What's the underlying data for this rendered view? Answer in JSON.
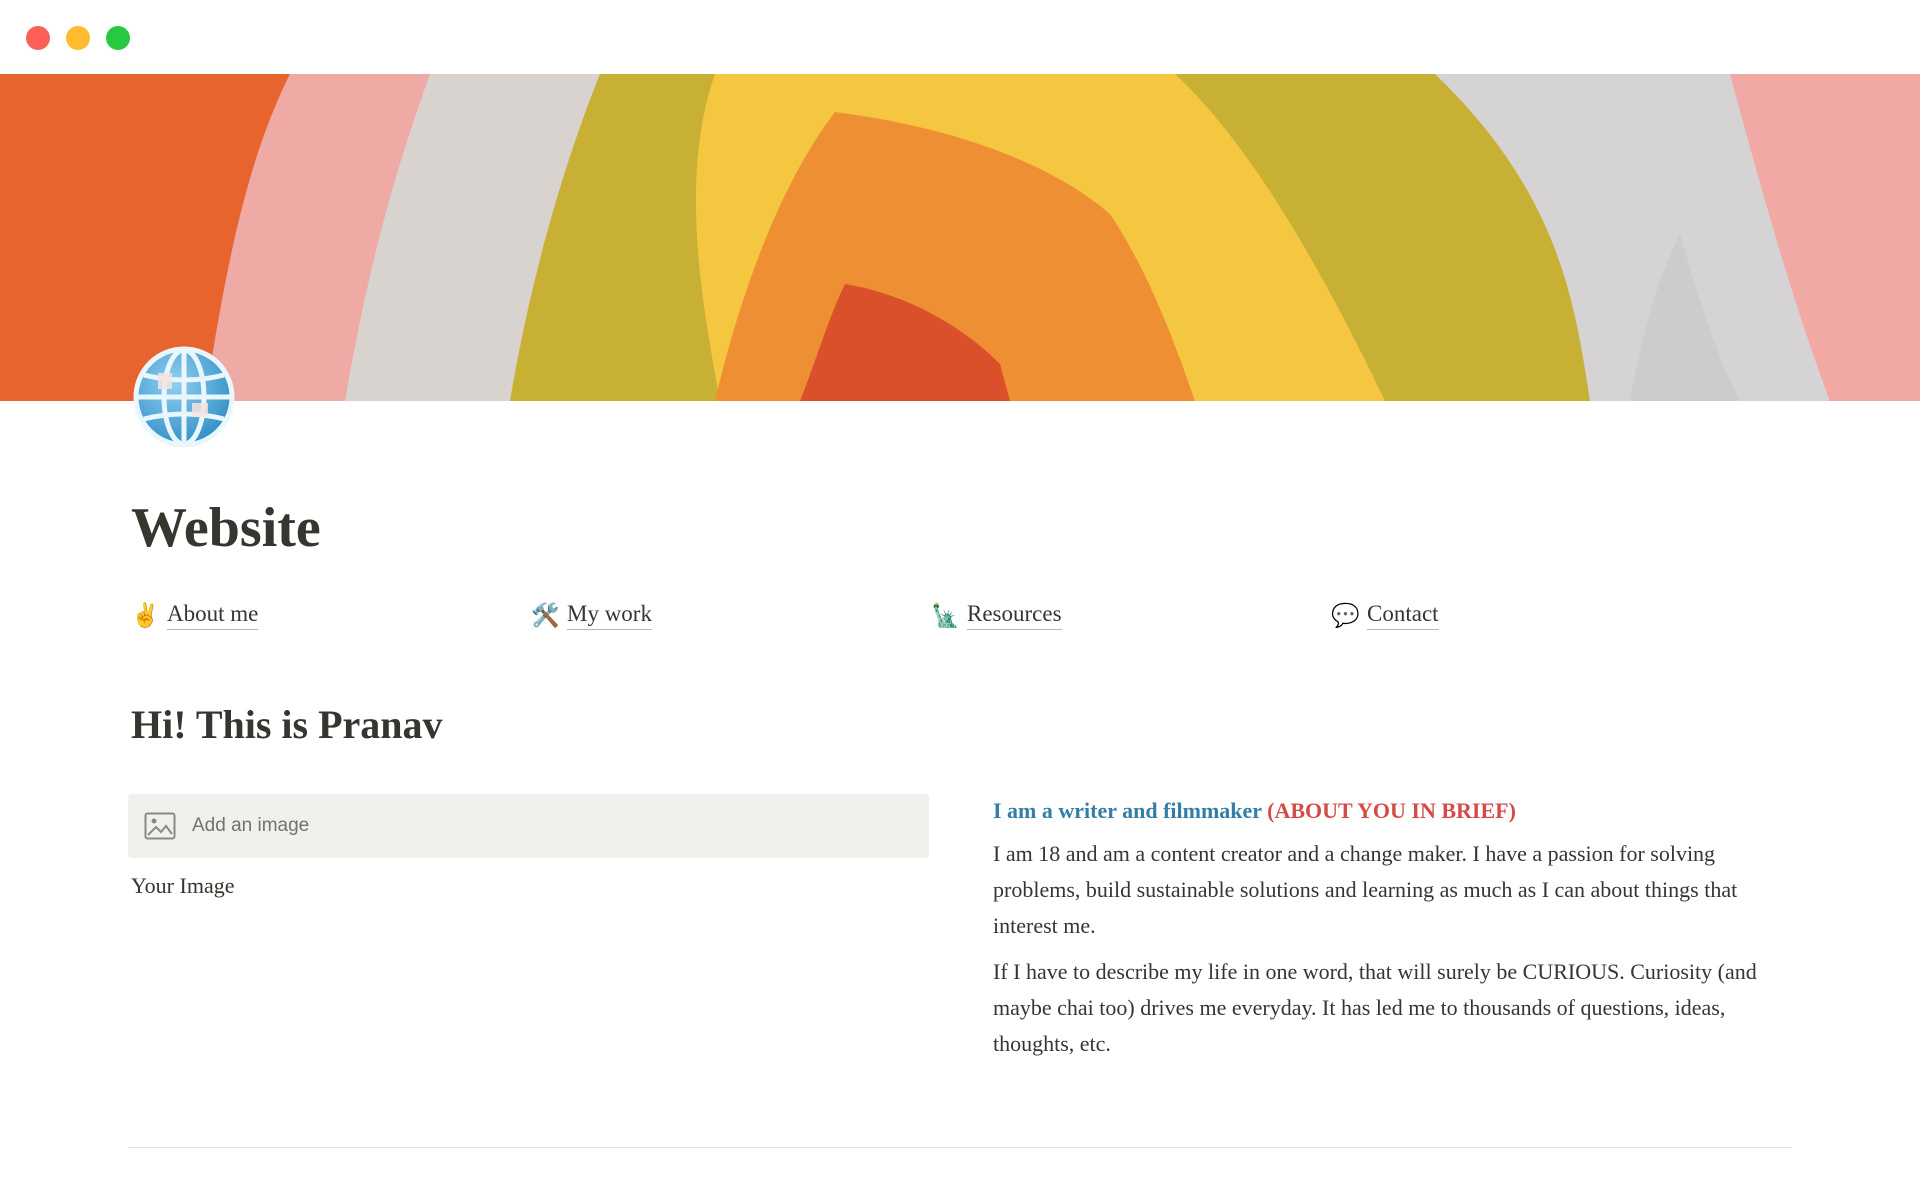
{
  "window": {
    "controls": [
      "close",
      "minimize",
      "zoom"
    ],
    "colors": {
      "close": "#fe5f57",
      "minimize": "#febc2e",
      "zoom": "#28c840"
    }
  },
  "page": {
    "icon": "globe-icon",
    "title": "Website"
  },
  "nav": [
    {
      "emoji": "✌️",
      "icon": "victory-hand-icon",
      "label": "About me"
    },
    {
      "emoji": "🛠️",
      "icon": "tools-icon",
      "label": "My work"
    },
    {
      "emoji": "🗽",
      "icon": "statue-of-liberty-icon",
      "label": "Resources"
    },
    {
      "emoji": "💬",
      "icon": "speech-bubble-icon",
      "label": "Contact"
    }
  ],
  "main": {
    "heading": "Hi! This is Pranav",
    "image_block": {
      "icon": "image-icon",
      "label": "Add an image",
      "caption": "Your Image"
    },
    "about": {
      "heading_blue": "I am a writer and filmmaker",
      "heading_red": "(ABOUT YOU IN BRIEF)",
      "paragraphs": [
        "I am 18 and am a content creator and a change maker. I have a passion for solving problems, build sustainable solutions and learning as much as I can about things that interest me.",
        "If I have to describe my life in one word, that will surely be CURIOUS. Curiosity (and maybe chai too) drives me everyday. It has led me to thousands of questions, ideas, thoughts, etc."
      ]
    }
  },
  "colors": {
    "text": "#37352f",
    "blue_text": "#337ea9",
    "red_text": "#d44c47",
    "placeholder_bg": "#f1f0ec"
  }
}
